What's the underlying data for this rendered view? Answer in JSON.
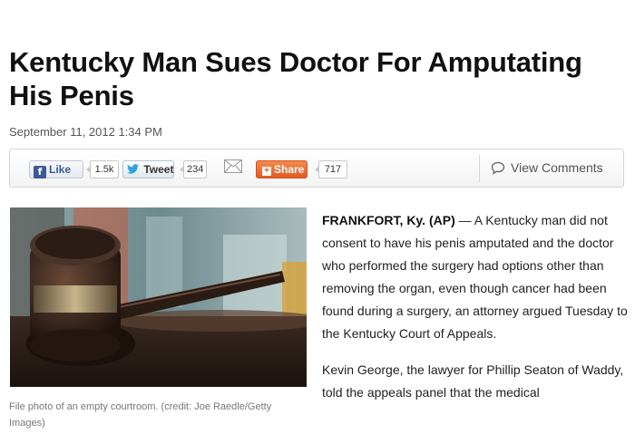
{
  "article": {
    "headline": "Kentucky Man Sues Doctor For Amputating His Penis",
    "date": "September 11, 2012 1:34 PM",
    "dateline": "FRANKFORT, Ky. (AP)",
    "paragraph1": " — A Kentucky man did not consent to have his penis amputated and the doctor who performed the surgery had options other than removing the organ, even though cancer had been found during a surgery, an attorney argued Tuesday to the Kentucky Court of Appeals.",
    "paragraph2": "Kevin George, the lawyer for Phillip Seaton of Waddy, told the appeals panel that the medical"
  },
  "social": {
    "like_label": "Like",
    "like_count": "1.5k",
    "tweet_label": "Tweet",
    "tweet_count": "234",
    "share_label": "Share",
    "share_count": "717",
    "view_comments_label": "View Comments",
    "icons": [
      "facebook-icon",
      "twitter-bird-icon",
      "mail-icon",
      "plus-icon",
      "comment-bubble-icon"
    ]
  },
  "photo": {
    "caption": "File photo of an empty courtroom. (credit: Joe Raedle/Getty Images)"
  },
  "colors": {
    "facebook_blue": "#3b5998",
    "twitter_blue": "#2ea4e0",
    "share_orange": "#e35a22"
  }
}
